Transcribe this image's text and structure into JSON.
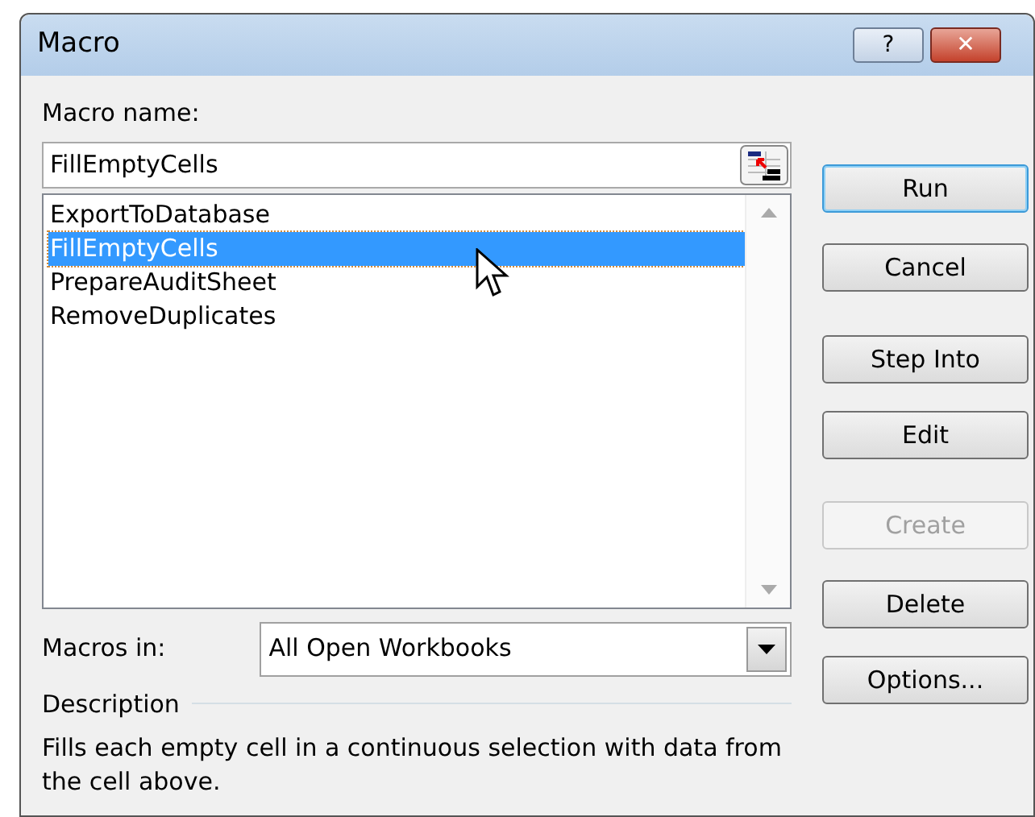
{
  "window": {
    "title": "Macro",
    "help_button": "?",
    "close_button": "✕"
  },
  "macro_name": {
    "label": "Macro name:",
    "value": "FillEmptyCells"
  },
  "macros": [
    {
      "name": "ExportToDatabase",
      "selected": false
    },
    {
      "name": "FillEmptyCells",
      "selected": true
    },
    {
      "name": "PrepareAuditSheet",
      "selected": false
    },
    {
      "name": "RemoveDuplicates",
      "selected": false
    }
  ],
  "buttons": [
    {
      "label": "Run",
      "default": true,
      "disabled": false
    },
    {
      "label": "Cancel",
      "default": false,
      "disabled": false
    },
    {
      "label": "Step Into",
      "default": false,
      "disabled": false
    },
    {
      "label": "Edit",
      "default": false,
      "disabled": false
    },
    {
      "label": "Create",
      "default": false,
      "disabled": true
    },
    {
      "label": "Delete",
      "default": false,
      "disabled": false
    },
    {
      "label": "Options...",
      "default": false,
      "disabled": false
    }
  ],
  "macros_in": {
    "label": "Macros in:",
    "value": "All Open Workbooks"
  },
  "description": {
    "heading": "Description",
    "text": "Fills each empty cell in a continuous selection with data from the cell above."
  }
}
